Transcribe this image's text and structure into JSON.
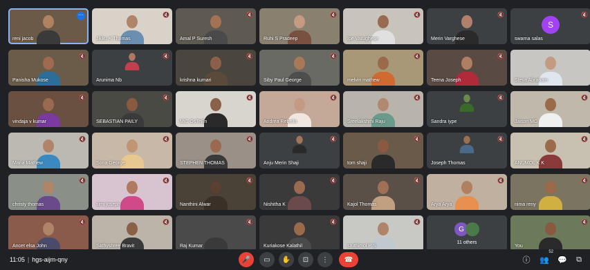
{
  "participants": [
    {
      "name": "reni jacob",
      "bg": "#6b5a48",
      "skin": "#b08260",
      "shirt": "#3a3a3a",
      "mic": "",
      "active": true,
      "more": true
    },
    {
      "name": "Jikku K Thomas",
      "bg": "#d8d2c8",
      "skin": "#b08468",
      "shirt": "#6a8fb0",
      "mic": "🔇"
    },
    {
      "name": "Amal P Suresh",
      "bg": "#5e5a52",
      "skin": "#a47252",
      "shirt": "#4a4a4a",
      "mic": "🔇"
    },
    {
      "name": "Ruhi S Pradeep",
      "bg": "#8a8070",
      "skin": "#c49a80",
      "shirt": "#7a5040",
      "mic": "🔇"
    },
    {
      "name": "Ipe Varughese",
      "bg": "#c8c4bc",
      "skin": "#9a6a50",
      "shirt": "#e0e0e0",
      "mic": "🔇"
    },
    {
      "name": "Merin Varghese",
      "bg": "#3c4043",
      "skin": "#b0806a",
      "shirt": "#2a2a2a",
      "mic": "🔇"
    },
    {
      "name": "swarna salas",
      "bg": "#3c4043",
      "avatar": "S",
      "avatar_color": "#a142f4",
      "mic": "🔇"
    },
    {
      "name": "Panisha Mukose",
      "bg": "#6a5c48",
      "skin": "#a06a50",
      "shirt": "#2c6e9a",
      "mic": "🔇"
    },
    {
      "name": "Arunima Nb",
      "bg": "#3c4043",
      "skin": "#b07860",
      "shirt": "#c04050",
      "mic": "🔇",
      "small": true
    },
    {
      "name": "krishna kumari",
      "bg": "#4a463e",
      "skin": "#8a6048",
      "shirt": "#5a4a3a",
      "mic": "🔇"
    },
    {
      "name": "Siby Paul George",
      "bg": "#6a6a64",
      "skin": "#a87858",
      "shirt": "#4e4e4e",
      "mic": "🔇"
    },
    {
      "name": "melvin mathew",
      "bg": "#a89878",
      "skin": "#9a6a4a",
      "shirt": "#d06a30",
      "mic": "🔇"
    },
    {
      "name": "Teena Joseph",
      "bg": "#5a4a44",
      "skin": "#b07e62",
      "shirt": "#b02a3a",
      "mic": "🔇"
    },
    {
      "name": "Steya Abraham",
      "bg": "#c8c6c2",
      "skin": "#c49a82",
      "shirt": "#e0e6ee",
      "mic": ""
    },
    {
      "name": "vindaja v kumar",
      "bg": "#6a5040",
      "skin": "#9a6a50",
      "shirt": "#7a3aa0",
      "mic": "🔇"
    },
    {
      "name": "SEBASTIAN PAILY",
      "bg": "#4a4a44",
      "skin": "#8a5a40",
      "shirt": "#3a3a3a",
      "mic": "🔇"
    },
    {
      "name": "MiC OsTeEn",
      "bg": "#d8d4ce",
      "skin": "#8a6048",
      "shirt": "#2a2a2a",
      "mic": "🔇"
    },
    {
      "name": "Andrea Rebello",
      "bg": "#c4a898",
      "skin": "#c49a82",
      "shirt": "#f0e8e0",
      "mic": "🔇"
    },
    {
      "name": "Sreelakshmi Raju",
      "bg": "#b8b4ac",
      "skin": "#b08a70",
      "shirt": "#6a9a8a",
      "mic": "🔇"
    },
    {
      "name": "Sandra iype",
      "bg": "#3c4043",
      "skin": "#6a8a4a",
      "shirt": "#3a6a2a",
      "mic": "🔇",
      "small": true
    },
    {
      "name": "Jaison MG",
      "bg": "#c0b8aa",
      "skin": "#9a6a4a",
      "shirt": "#f0f0f0",
      "mic": "🔇"
    },
    {
      "name": "Maria Mathew",
      "bg": "#bcb8b2",
      "skin": "#b08468",
      "shirt": "#3a8ac0",
      "mic": "🔇"
    },
    {
      "name": "Sona George",
      "bg": "#c8b8a8",
      "skin": "#c09474",
      "shirt": "#e8c890",
      "mic": "🔇"
    },
    {
      "name": "STEPHEN THOMAS",
      "bg": "#9a9088",
      "skin": "#9a6a50",
      "shirt": "#3a3a3a",
      "mic": "🔇"
    },
    {
      "name": "Anju Merin Shaji",
      "bg": "#3c4043",
      "skin": "#a07458",
      "shirt": "#2a2a2a",
      "mic": "🔇",
      "small": true
    },
    {
      "name": "tom shaji",
      "bg": "#6a5a4a",
      "skin": "#8a5a40",
      "shirt": "#2a2a2a",
      "mic": "🔇"
    },
    {
      "name": "Joseph Thomas",
      "bg": "#3c4043",
      "skin": "#9a7050",
      "shirt": "#4a6a8a",
      "mic": "🔇",
      "small": true
    },
    {
      "name": "ANUMOL K K",
      "bg": "#c8c0b0",
      "skin": "#9a6a4a",
      "shirt": "#8a3a3a",
      "mic": "🔇"
    },
    {
      "name": "christy thomas",
      "bg": "#8a9088",
      "skin": "#b08468",
      "shirt": "#6a4a8a",
      "mic": "🔇"
    },
    {
      "name": "simi joseph",
      "bg": "#d8c4d0",
      "skin": "#b07a62",
      "shirt": "#d04a8a",
      "mic": "🔇"
    },
    {
      "name": "Nanthini Alwar",
      "bg": "#4a4236",
      "skin": "#5a4030",
      "shirt": "#3a3028",
      "mic": "🔇"
    },
    {
      "name": "Nishitha K",
      "bg": "#3a3a3a",
      "skin": "#9a6a50",
      "shirt": "#6a4a4a",
      "mic": "🔇"
    },
    {
      "name": "Kajol Thomas",
      "bg": "#5a5048",
      "skin": "#a07056",
      "shirt": "#c0a080",
      "mic": "🔇"
    },
    {
      "name": "Arya Arya",
      "bg": "#c0b0a0",
      "skin": "#b08060",
      "shirt": "#e89050",
      "mic": "🔇"
    },
    {
      "name": "nima reny",
      "bg": "#7a7460",
      "skin": "#9a6a4a",
      "shirt": "#d0b040",
      "mic": "🔇"
    },
    {
      "name": "Ancet elsa John",
      "bg": "#8a5a4a",
      "skin": "#b08468",
      "shirt": "#4a4a6a",
      "mic": "🔇"
    },
    {
      "name": "Sathyshree Bravit",
      "bg": "#bcb4a8",
      "skin": "#8a6048",
      "shirt": "#3a3a3a",
      "mic": "🔇"
    },
    {
      "name": "Raj Kumar",
      "bg": "#4a4a4a",
      "skin": "#4a4a4a",
      "shirt": "#3a3a3a",
      "mic": "🔇"
    },
    {
      "name": "Kuriakose Kalathil",
      "bg": "#3a3a3a",
      "skin": "#9a6a4a",
      "shirt": "#4a4a4a",
      "mic": "🔇"
    },
    {
      "name": "sruthimol P S",
      "bg": "#c8c8c4",
      "skin": "#b08468",
      "shirt": "#c0c8d0",
      "mic": "🔇"
    },
    {
      "name": "11 others",
      "bg": "#3c4043",
      "others": true,
      "avatar": "G",
      "avatar_color": "#7e57c2",
      "mic": ""
    },
    {
      "name": "You",
      "bg": "#6a7a5a",
      "skin": "#8a5a40",
      "shirt": "#2a2a2a",
      "mic": "🔇"
    }
  ],
  "bottom_bar": {
    "time": "11:05",
    "separator": "|",
    "meeting_code": "hgs-aijm-qny",
    "participant_count": "52",
    "controls": {
      "mic": "mic-off-icon",
      "camera": "camera-icon",
      "raise_hand": "raise-hand-icon",
      "present": "present-screen-icon",
      "more": "more-options-icon",
      "end_call": "end-call-icon"
    }
  }
}
